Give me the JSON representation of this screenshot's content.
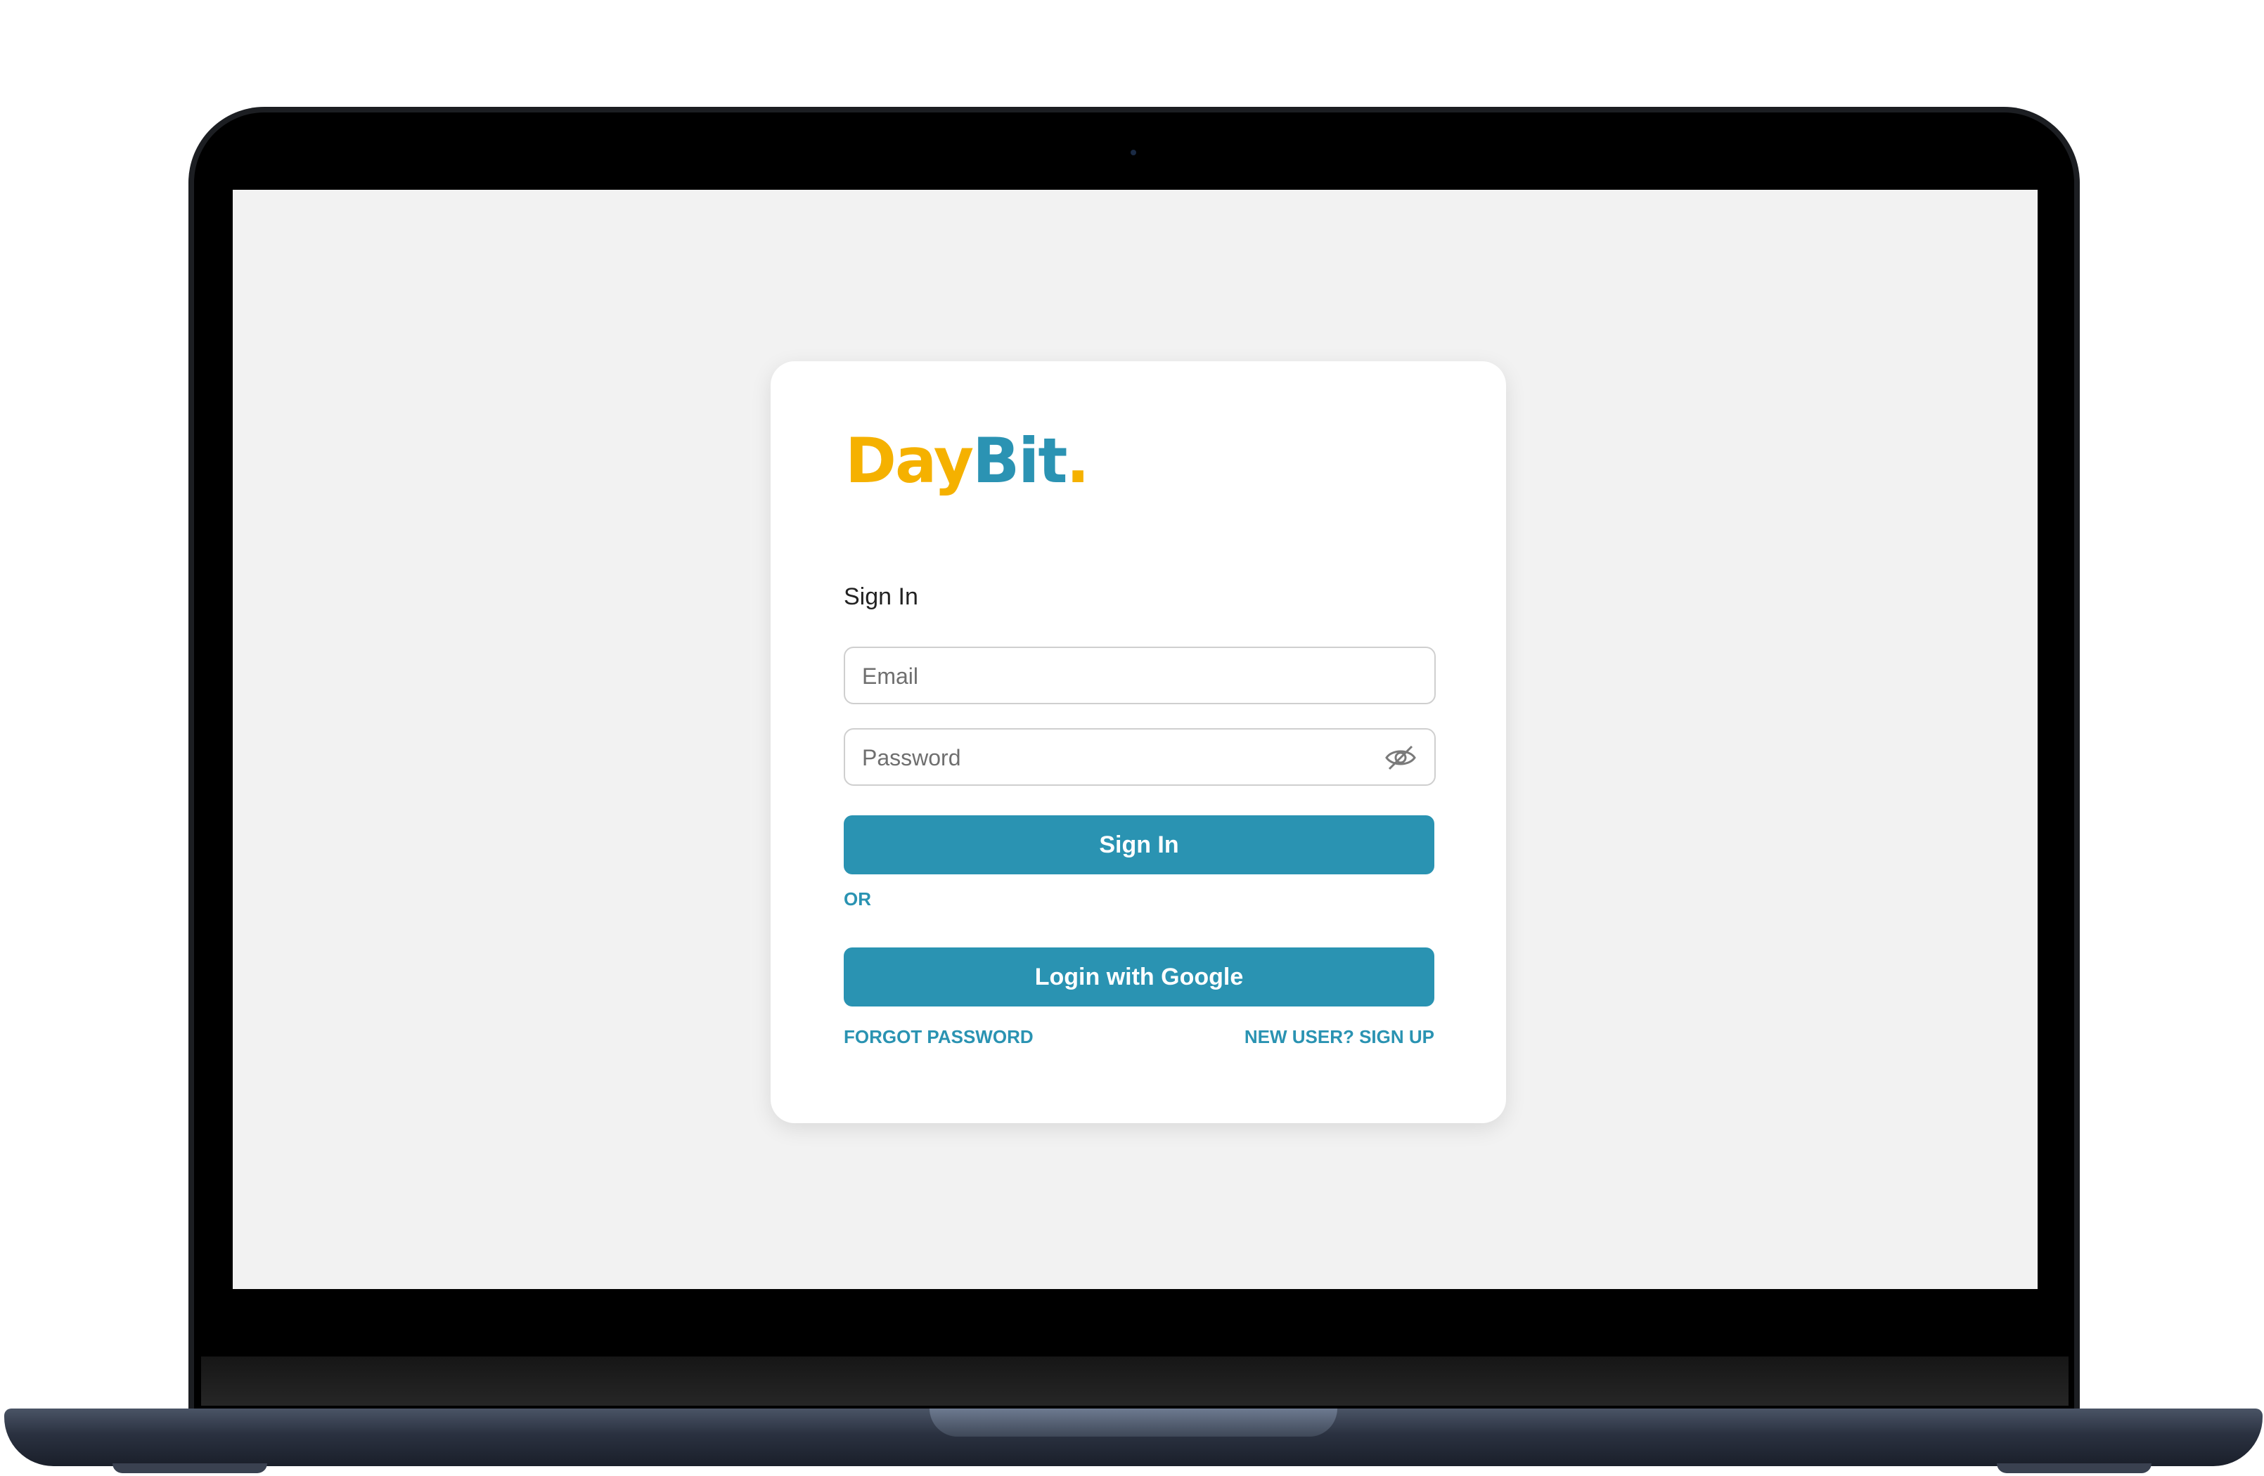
{
  "logo": {
    "part1": "Day",
    "part2": "Bit",
    "part3": "."
  },
  "form": {
    "title": "Sign In",
    "email_placeholder": "Email",
    "password_placeholder": "Password",
    "signin_label": "Sign In",
    "or_label": "OR",
    "google_label": "Login with Google",
    "forgot_label": "FORGOT PASSWORD",
    "signup_label": "NEW USER? SIGN UP"
  },
  "icons": {
    "password_toggle": "eye-slash-icon"
  },
  "colors": {
    "brand_yellow": "#f5b100",
    "brand_teal": "#2a93b2",
    "screen_bg": "#f2f2f2"
  }
}
